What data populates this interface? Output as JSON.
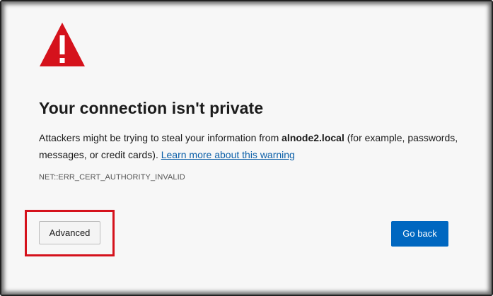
{
  "page": {
    "title": "Your connection isn't private",
    "description": {
      "prefix": "Attackers might be trying to steal your information from ",
      "host": "alnode2.local",
      "suffix": " (for example, passwords, messages, or credit cards). ",
      "link": "Learn more about this warning"
    },
    "error_code": "NET::ERR_CERT_AUTHORITY_INVALID"
  },
  "buttons": {
    "advanced": "Advanced",
    "go_back": "Go back"
  },
  "icons": {
    "warning": "warning-triangle-icon"
  },
  "colors": {
    "warning_red": "#d5121c",
    "primary_button": "#0067c0",
    "link": "#0b5fa8",
    "highlight_box": "#d5121c"
  }
}
